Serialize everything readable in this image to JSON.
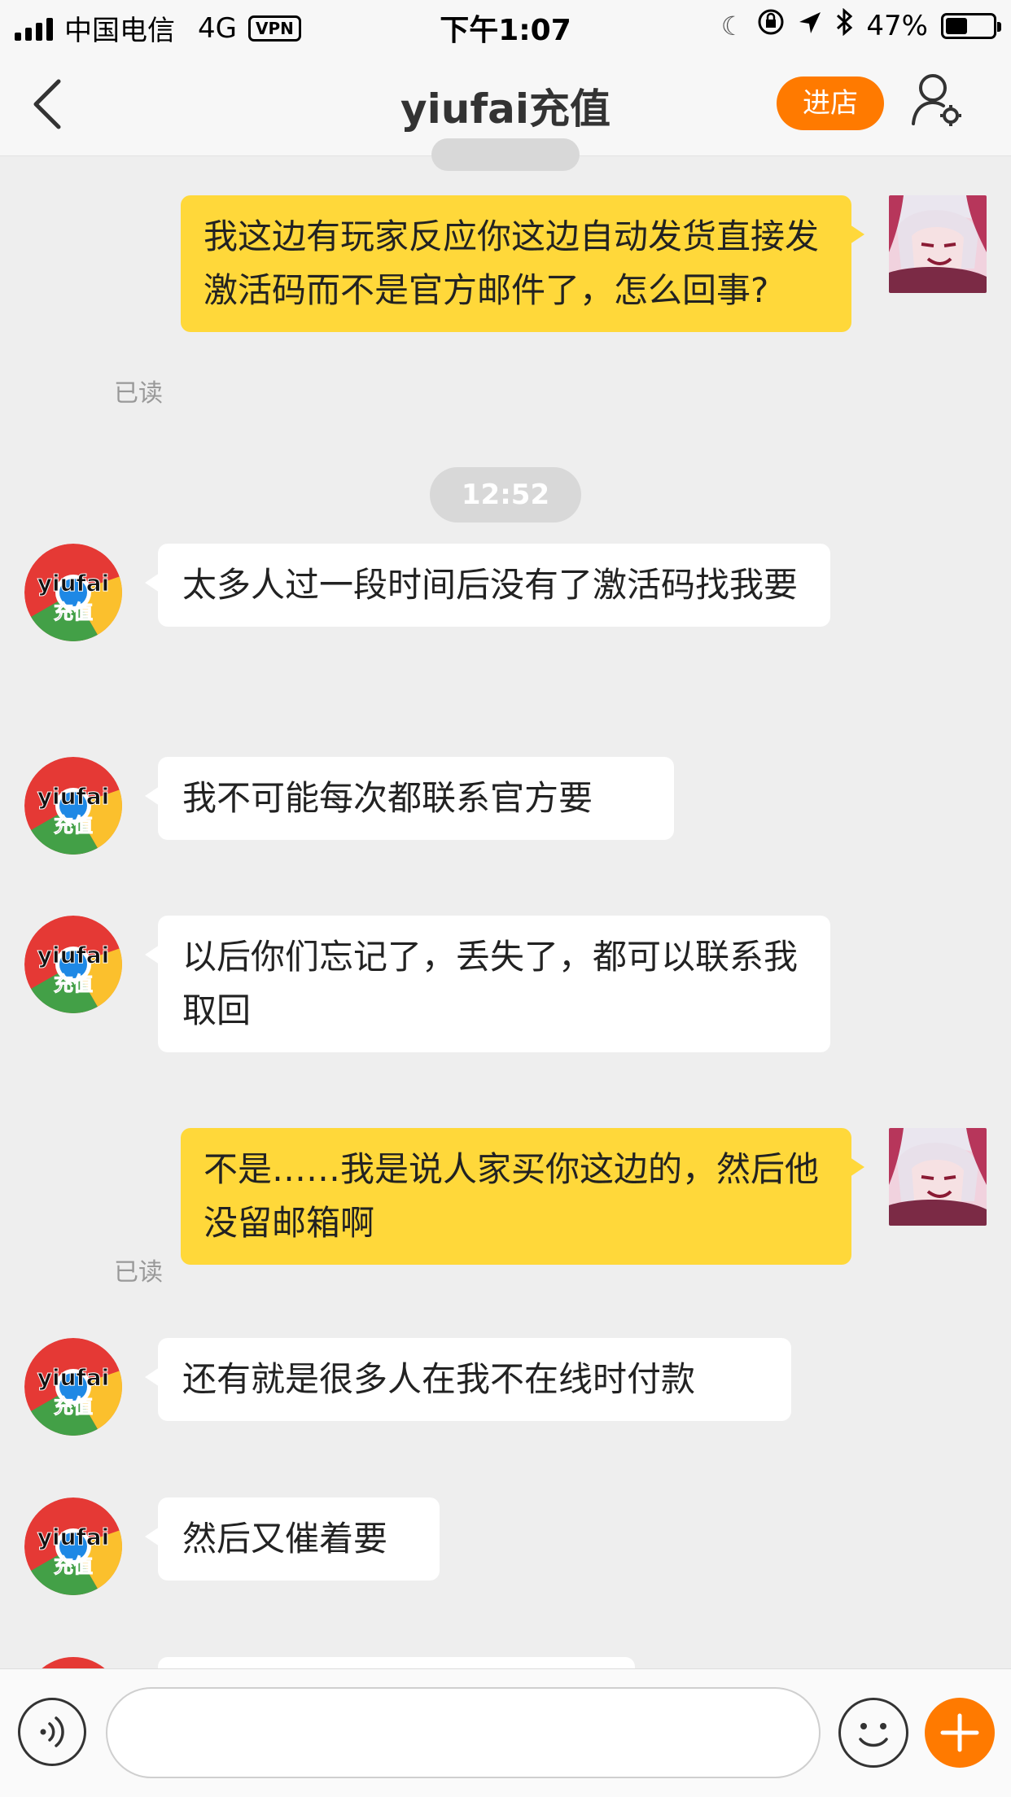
{
  "status_bar": {
    "carrier": "中国电信",
    "network": "4G",
    "vpn": "VPN",
    "time": "下午1:07",
    "battery": "47%",
    "battery_level": 0.47
  },
  "nav": {
    "title": "yiufai充值",
    "shop_button": "进店"
  },
  "messages": [
    {
      "from": "me",
      "text": "我这边有玩家反应你这边自动发货直接发激活码而不是官方邮件了，怎么回事?",
      "status": "已读"
    },
    {
      "type": "time",
      "text": "12:52"
    },
    {
      "from": "shop",
      "avatar_text": "yiufai充值",
      "text": "太多人过一段时间后没有了激活码找我要"
    },
    {
      "from": "shop",
      "avatar_text": "yiufai充值",
      "text": "我不可能每次都联系官方要"
    },
    {
      "from": "shop",
      "avatar_text": "yiufai充值",
      "text": "以后你们忘记了，丢失了，都可以联系我取回"
    },
    {
      "from": "me",
      "text": "不是……我是说人家买你这边的，然后他没留邮箱啊",
      "status": "已读"
    },
    {
      "from": "shop",
      "avatar_text": "yiufai充值",
      "text": "还有就是很多人在我不在线时付款"
    },
    {
      "from": "shop",
      "avatar_text": "yiufai充值",
      "text": "然后又催着要"
    }
  ],
  "input": {
    "placeholder": ""
  },
  "colors": {
    "accent": "#ff7a00",
    "outgoing_bubble": "#ffd83a",
    "incoming_bubble": "#ffffff",
    "background": "#eeeeee"
  },
  "icons": {
    "back": "chevron-left-icon",
    "user_settings": "user-gear-icon",
    "voice": "voice-icon",
    "emoji": "smiley-icon",
    "plus": "plus-icon"
  }
}
